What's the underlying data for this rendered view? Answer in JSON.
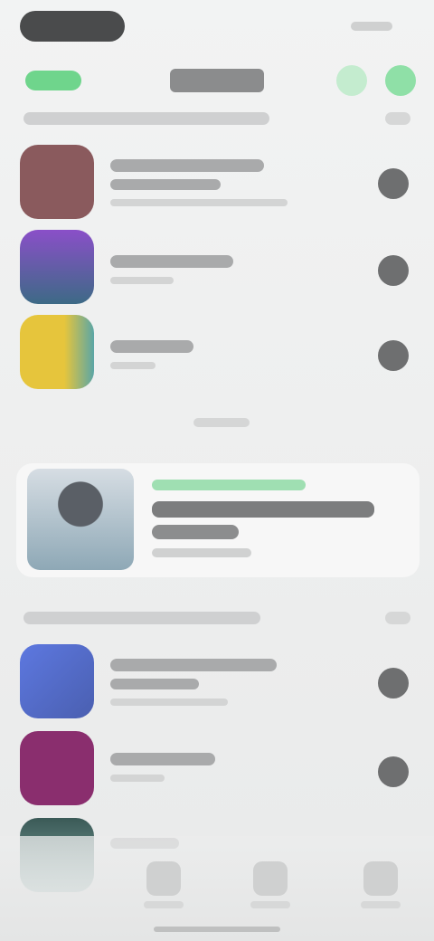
{
  "status_bar": {
    "time": "",
    "indicators": ""
  },
  "header": {
    "back_label": "",
    "title": "",
    "action_icons": [
      "share-icon",
      "more-icon"
    ]
  },
  "section_top": {
    "title": "",
    "see_all": ""
  },
  "apps_top": [
    {
      "name": "",
      "subtitle": "",
      "icon_color": "#8a5a5d"
    },
    {
      "name": "",
      "subtitle": "",
      "icon_color": "#7b4bb8"
    },
    {
      "name": "",
      "subtitle": "",
      "icon_color": "#e2c23f"
    }
  ],
  "feature": {
    "tag": "",
    "headline": "",
    "meta": ""
  },
  "section_bottom": {
    "title": "",
    "see_all": ""
  },
  "apps_bottom": [
    {
      "name": "",
      "subtitle": "",
      "icon_color": "#5d78e0"
    },
    {
      "name": "",
      "subtitle": "",
      "icon_color": "#8a2e6e"
    },
    {
      "name": "",
      "subtitle": "",
      "icon_color": "#3b5a57"
    }
  ],
  "tabs": [
    {
      "label": "",
      "icon": "today-icon"
    },
    {
      "label": "",
      "icon": "apps-icon"
    },
    {
      "label": "",
      "icon": "search-icon"
    }
  ],
  "colors": {
    "accent": "#6fd58c",
    "background": "#eceded"
  }
}
